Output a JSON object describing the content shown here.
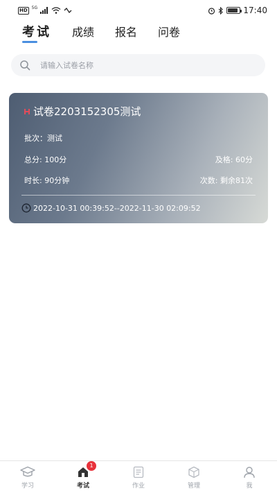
{
  "status_bar": {
    "hd_label": "HD",
    "network_label": "5G",
    "time": "17:40",
    "battery_level": 0.85
  },
  "top_tabs": [
    {
      "label": "考试",
      "active": true
    },
    {
      "label": "成绩",
      "active": false
    },
    {
      "label": "报名",
      "active": false
    },
    {
      "label": "问卷",
      "active": false
    }
  ],
  "search": {
    "placeholder": "请输入试卷名称",
    "icon": "search-icon"
  },
  "exam_card": {
    "title": "试卷2203152305测试",
    "batch": "批次：测试",
    "total_score": "总分: 100分",
    "pass_score": "及格: 60分",
    "duration": "时长: 90分钟",
    "attempts": "次数: 剩余81次",
    "time_range": "2022-10-31 00:39:52--2022-11-30 02:09:52",
    "icons": [
      "title-mark-icon",
      "clock-icon"
    ]
  },
  "bottom_nav": {
    "items": [
      {
        "label": "学习",
        "icon": "graduation-cap-icon",
        "active": false
      },
      {
        "label": "考试",
        "icon": "exam-icon",
        "active": true,
        "badge": "1"
      },
      {
        "label": "作业",
        "icon": "document-icon",
        "active": false
      },
      {
        "label": "管理",
        "icon": "box-icon",
        "active": false
      },
      {
        "label": "我",
        "icon": "user-icon",
        "active": false
      }
    ]
  },
  "colors": {
    "accent": "#4a8fe0",
    "badge": "#e8323b",
    "title_mark": "#e34b5a",
    "inactive_nav": "#9ea3aa"
  }
}
